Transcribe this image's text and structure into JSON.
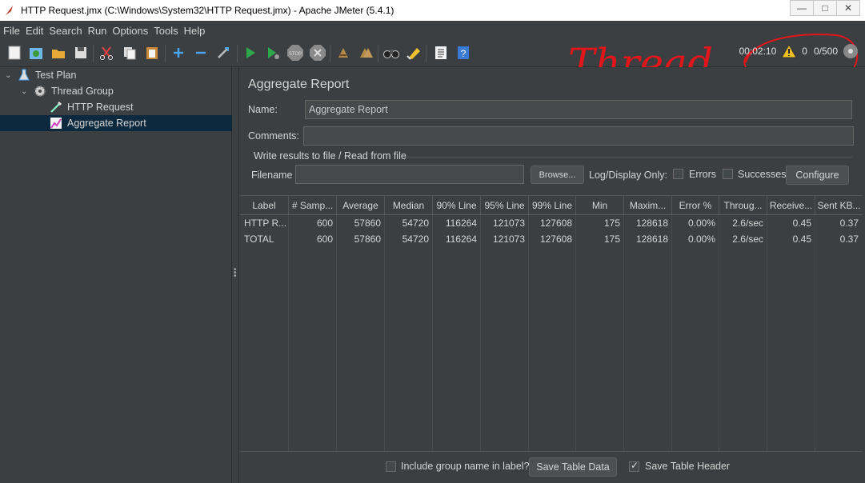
{
  "window": {
    "title": "HTTP Request.jmx (C:\\Windows\\System32\\HTTP Request.jmx) - Apache JMeter (5.4.1)",
    "controls": [
      "—",
      "□",
      "✕"
    ]
  },
  "menu": [
    "File",
    "Edit",
    "Search",
    "Run",
    "Options",
    "Tools",
    "Help"
  ],
  "toolbar": {
    "icons": [
      "new-icon",
      "templates-icon",
      "open-icon",
      "save-icon",
      "cut-icon",
      "copy-icon",
      "paste-icon",
      "expand-icon",
      "collapse-icon",
      "toggle-icon",
      "start-icon",
      "start-no-pause-icon",
      "stop-icon",
      "shutdown-icon",
      "clear-icon",
      "clear-all-icon",
      "search-icon",
      "reset-search-icon",
      "function-helper-icon",
      "help-icon"
    ]
  },
  "annotation": {
    "text": "Thread",
    "color": "#e0161b"
  },
  "status": {
    "elapsed": "00:02:10",
    "warnings": "0",
    "threads": "0/500"
  },
  "tree": [
    {
      "label": "Test Plan",
      "icon": "flask-icon",
      "level": 0,
      "expanded": true
    },
    {
      "label": "Thread Group",
      "icon": "gear-icon",
      "level": 1,
      "expanded": true
    },
    {
      "label": "HTTP Request",
      "icon": "pipette-icon",
      "level": 2
    },
    {
      "label": "Aggregate Report",
      "icon": "chart-icon",
      "level": 2,
      "selected": true
    }
  ],
  "panel": {
    "title": "Aggregate Report",
    "name_label": "Name:",
    "name_value": "Aggregate Report",
    "comments_label": "Comments:",
    "comments_value": "",
    "file_group_title": "Write results to file / Read from file",
    "filename_label": "Filename",
    "filename_value": "",
    "browse_button": "Browse...",
    "log_display_label": "Log/Display Only:",
    "errors_label": "Errors",
    "successes_label": "Successes",
    "configure_button": "Configure"
  },
  "table": {
    "columns": [
      "Label",
      "# Samp...",
      "Average",
      "Median",
      "90% Line",
      "95% Line",
      "99% Line",
      "Min",
      "Maxim...",
      "Error %",
      "Throug...",
      "Receive...",
      "Sent KB..."
    ],
    "rows": [
      [
        "HTTP R...",
        "600",
        "57860",
        "54720",
        "116264",
        "121073",
        "127608",
        "175",
        "128618",
        "0.00%",
        "2.6/sec",
        "0.45",
        "0.37"
      ],
      [
        "TOTAL",
        "600",
        "57860",
        "54720",
        "116264",
        "121073",
        "127608",
        "175",
        "128618",
        "0.00%",
        "2.6/sec",
        "0.45",
        "0.37"
      ]
    ]
  },
  "bottom": {
    "include_group_label": "Include group name in label?",
    "include_group_checked": false,
    "save_table_data": "Save Table Data",
    "save_table_header_label": "Save Table Header",
    "save_table_header_checked": true
  }
}
